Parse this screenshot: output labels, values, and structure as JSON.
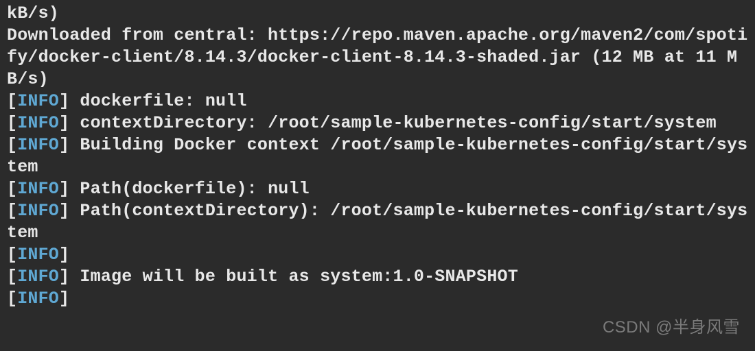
{
  "terminal": {
    "lines": [
      {
        "type": "plain",
        "text": "kB/s)"
      },
      {
        "type": "plain",
        "text": "Downloaded from central: https://repo.maven.apache.org/maven2/com/spotify/docker-client/8.14.3/docker-client-8.14.3-shaded.jar (12 MB at 11 MB/s)"
      },
      {
        "type": "info",
        "text": " dockerfile: null"
      },
      {
        "type": "info",
        "text": " contextDirectory: /root/sample-kubernetes-config/start/system"
      },
      {
        "type": "info",
        "text": " Building Docker context /root/sample-kubernetes-config/start/system"
      },
      {
        "type": "info",
        "text": " Path(dockerfile): null"
      },
      {
        "type": "info",
        "text": " Path(contextDirectory): /root/sample-kubernetes-config/start/system"
      },
      {
        "type": "info",
        "text": ""
      },
      {
        "type": "info",
        "text": " Image will be built as system:1.0-SNAPSHOT"
      },
      {
        "type": "info",
        "text": ""
      }
    ],
    "level_label": "INFO",
    "bracket_open": "[",
    "bracket_close": "]"
  },
  "watermark": "CSDN @半身风雪"
}
